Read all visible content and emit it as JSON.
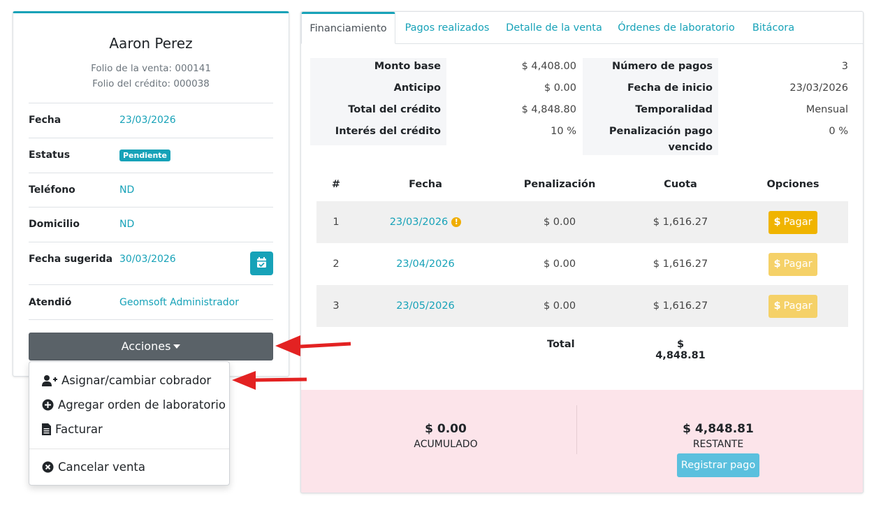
{
  "client": {
    "name": "Aaron Perez",
    "folio_venta": "Folio de la venta: 000141",
    "folio_credito": "Folio del crédito: 000038"
  },
  "info": {
    "fecha": {
      "label": "Fecha",
      "value": "23/03/2026"
    },
    "estatus": {
      "label": "Estatus",
      "value": "Pendiente"
    },
    "telefono": {
      "label": "Teléfono",
      "value": "ND"
    },
    "domicilio": {
      "label": "Domicilio",
      "value": "ND"
    },
    "fecha_sugerida": {
      "label": "Fecha sugerida",
      "value": "30/03/2026"
    },
    "atendio": {
      "label": "Atendió",
      "value": "Geomsoft Administrador"
    }
  },
  "acciones_label": "Acciones",
  "dropdown": {
    "asignar": "Asignar/cambiar cobrador",
    "agregar_orden": "Agregar orden de laboratorio",
    "facturar": "Facturar",
    "cancelar": "Cancelar venta"
  },
  "tabs": {
    "financiamiento": "Financiamiento",
    "pagos": "Pagos realizados",
    "detalle": "Detalle de la venta",
    "ordenes": "Órdenes de laboratorio",
    "bitacora": "Bitácora"
  },
  "summary": {
    "monto_base": {
      "label": "Monto base",
      "value": "$ 4,408.00"
    },
    "anticipo": {
      "label": "Anticipo",
      "value": "$ 0.00"
    },
    "total_credito": {
      "label": "Total del crédito",
      "value": "$ 4,848.80"
    },
    "interes": {
      "label": "Interés del crédito",
      "value": "10 %"
    },
    "num_pagos": {
      "label": "Número de pagos",
      "value": "3"
    },
    "fecha_inicio": {
      "label": "Fecha de inicio",
      "value": "23/03/2026"
    },
    "temporalidad": {
      "label": "Temporalidad",
      "value": "Mensual"
    },
    "penalizacion_line1": "Penalización pago",
    "penalizacion_line2": "vencido",
    "penalizacion_value": "0 %"
  },
  "table": {
    "headers": {
      "num": "#",
      "fecha": "Fecha",
      "penalizacion": "Penalización",
      "cuota": "Cuota",
      "opciones": "Opciones"
    },
    "rows": [
      {
        "num": "1",
        "fecha": "23/03/2026",
        "penalizacion": "$ 0.00",
        "cuota": "$ 1,616.27",
        "action": "Pagar",
        "enabled": true,
        "warning": true
      },
      {
        "num": "2",
        "fecha": "23/04/2026",
        "penalizacion": "$ 0.00",
        "cuota": "$ 1,616.27",
        "action": "Pagar",
        "enabled": false,
        "warning": false
      },
      {
        "num": "3",
        "fecha": "23/05/2026",
        "penalizacion": "$ 0.00",
        "cuota": "$ 1,616.27",
        "action": "Pagar",
        "enabled": false,
        "warning": false
      }
    ],
    "total_label": "Total",
    "total_value": "$ 4,848.81"
  },
  "footer": {
    "acumulado_amount": "$ 0.00",
    "acumulado_label": "ACUMULADO",
    "restante_amount": "$ 4,848.81",
    "restante_label": "RESTANTE",
    "registrar_label": "Registrar pago"
  },
  "colors": {
    "accent": "#17a2b8",
    "warning": "#f0b400",
    "footer_bg": "#fce4ea",
    "arrow": "#e32222"
  }
}
